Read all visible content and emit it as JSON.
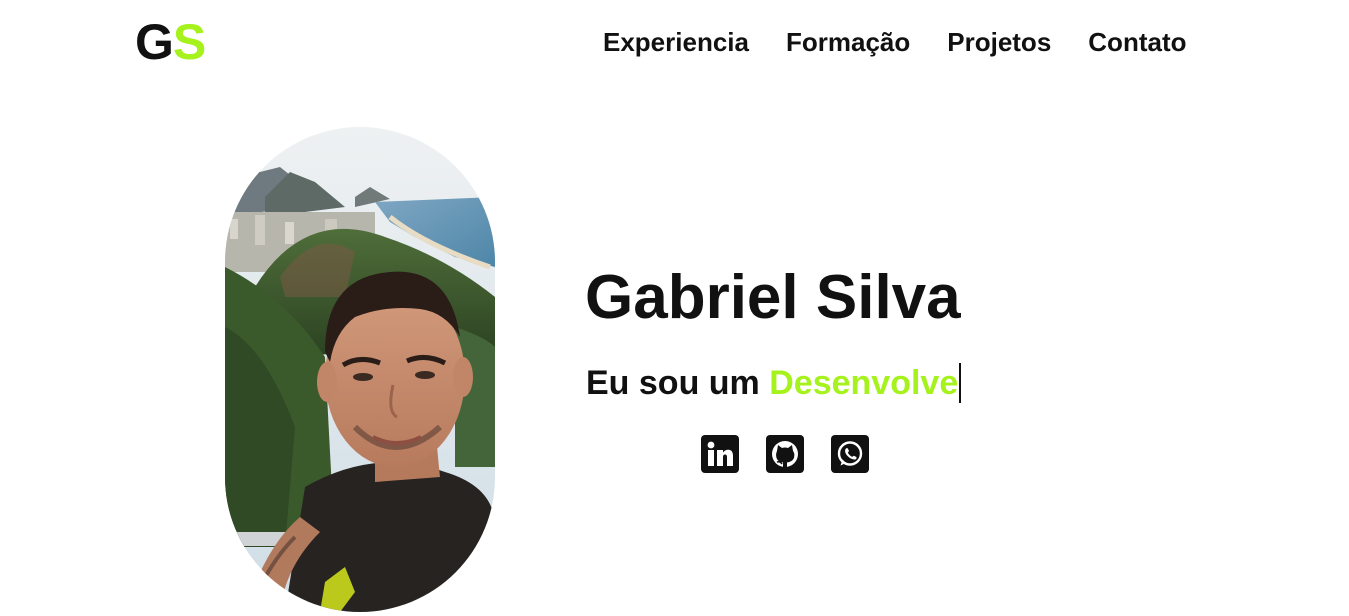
{
  "header": {
    "logo_first": "G",
    "logo_second": "S",
    "nav": [
      {
        "label": "Experiencia"
      },
      {
        "label": "Formação"
      },
      {
        "label": "Projetos"
      },
      {
        "label": "Contato"
      }
    ]
  },
  "hero": {
    "name": "Gabriel Silva",
    "intro": "Eu sou um ",
    "role_typed": "Desenvolve"
  },
  "socials": [
    {
      "icon": "linkedin-icon"
    },
    {
      "icon": "github-icon"
    },
    {
      "icon": "whatsapp-icon"
    }
  ],
  "colors": {
    "accent": "#a6f21c",
    "text": "#111111",
    "background": "#ffffff"
  }
}
